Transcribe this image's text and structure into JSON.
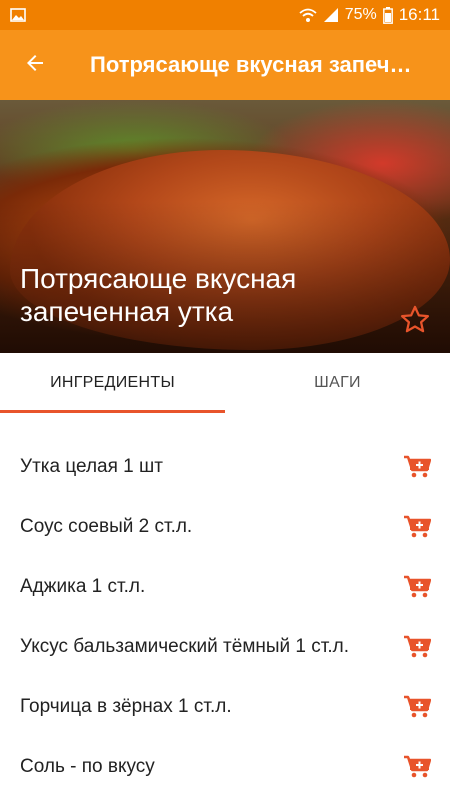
{
  "status_bar": {
    "battery": "75%",
    "time": "16:11"
  },
  "app_bar": {
    "title": "Потрясающе вкусная запеч…"
  },
  "hero": {
    "title": "Потрясающе вкусная запеченная утка"
  },
  "tabs": [
    {
      "label": "ИНГРЕДИЕНТЫ",
      "active": true
    },
    {
      "label": "ШАГИ",
      "active": false
    }
  ],
  "ingredients": [
    {
      "text": "Утка целая 1 шт"
    },
    {
      "text": "Соус соевый 2 ст.л."
    },
    {
      "text": "Аджика 1 ст.л."
    },
    {
      "text": "Уксус бальзамический тёмный 1 ст.л."
    },
    {
      "text": "Горчица в зёрнах 1 ст.л."
    },
    {
      "text": "Соль - по вкусу"
    }
  ],
  "colors": {
    "status_bar": "#f08000",
    "app_bar": "#f7931a",
    "accent": "#e8542b"
  },
  "icons": {
    "back": "arrow-left-icon",
    "favorite": "star-outline-icon",
    "add_to_cart": "cart-plus-icon"
  }
}
